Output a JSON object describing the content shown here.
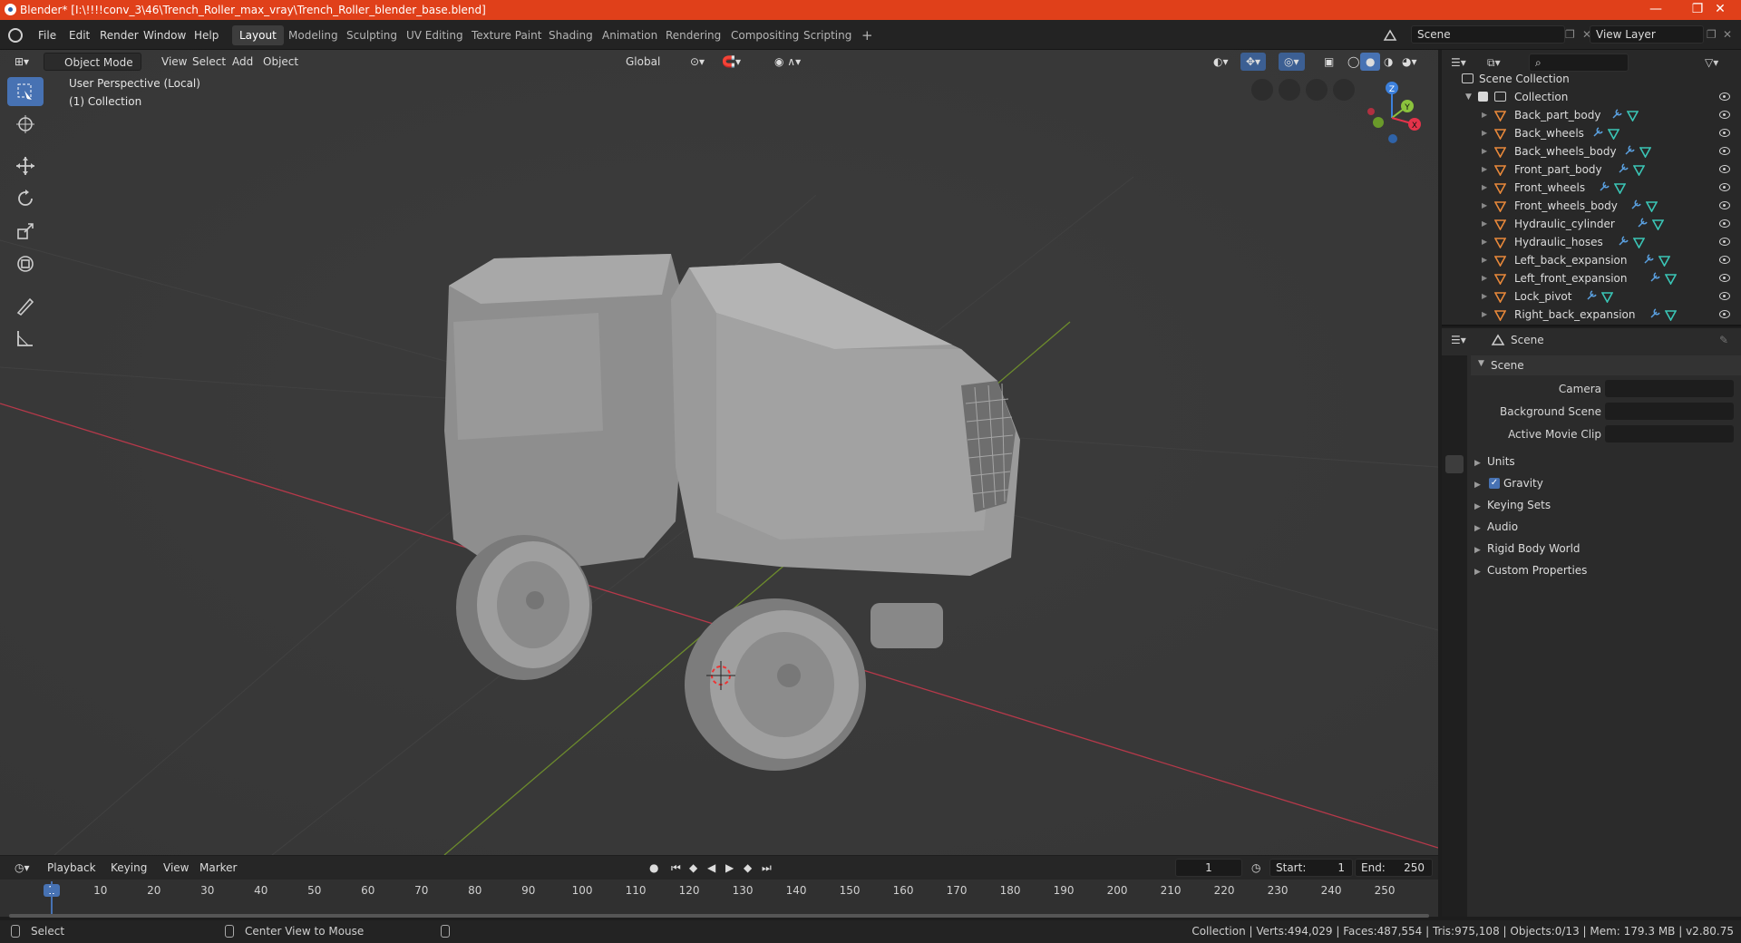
{
  "window": {
    "title": "Blender* [I:\\!!!!conv_3\\46\\Trench_Roller_max_vray\\Trench_Roller_blender_base.blend]",
    "controls": [
      "—",
      "❐",
      "✕"
    ]
  },
  "menu": [
    "File",
    "Edit",
    "Render",
    "Window",
    "Help"
  ],
  "workspaces": [
    "Layout",
    "Modeling",
    "Sculpting",
    "UV Editing",
    "Texture Paint",
    "Shading",
    "Animation",
    "Rendering",
    "Compositing",
    "Scripting"
  ],
  "add_workspace": "+",
  "scene_selector": {
    "value": "Scene"
  },
  "viewlayer_selector": {
    "value": "View Layer"
  },
  "viewport": {
    "mode": "Object Mode",
    "menus": [
      "View",
      "Select",
      "Add",
      "Object"
    ],
    "transform_orientation": "Global",
    "overlay_text": [
      "User Perspective (Local)",
      "(1) Collection"
    ],
    "gizmo_axes": [
      "Z",
      "Y",
      "X"
    ]
  },
  "outliner": {
    "root": "Scene Collection",
    "collection": "Collection",
    "items": [
      "Back_part_body",
      "Back_wheels",
      "Back_wheels_body",
      "Front_part_body",
      "Front_wheels",
      "Front_wheels_body",
      "Hydraulic_cylinder",
      "Hydraulic_hoses",
      "Left_back_expansion",
      "Left_front_expansion",
      "Lock_pivot",
      "Right_back_expansion"
    ]
  },
  "properties": {
    "context": "Scene",
    "panel_title": "Scene",
    "fields": [
      "Camera",
      "Background Scene",
      "Active Movie Clip"
    ],
    "subpanels": [
      "Units",
      "Gravity",
      "Keying Sets",
      "Audio",
      "Rigid Body World",
      "Custom Properties"
    ],
    "gravity_checked": true
  },
  "timeline": {
    "menus": [
      "Playback",
      "Keying",
      "View",
      "Marker"
    ],
    "current_frame": "1",
    "start_label": "Start:",
    "start": "1",
    "end_label": "End:",
    "end": "250",
    "ruler": [
      "1",
      "10",
      "20",
      "30",
      "40",
      "50",
      "60",
      "70",
      "80",
      "90",
      "100",
      "110",
      "120",
      "130",
      "140",
      "150",
      "160",
      "170",
      "180",
      "190",
      "200",
      "210",
      "220",
      "230",
      "240",
      "250"
    ]
  },
  "statusbar": {
    "left": "Select",
    "middle": "Center View to Mouse",
    "right": "Collection | Verts:494,029 | Faces:487,554 | Tris:975,108 | Objects:0/13 | Mem: 179.3 MB | v2.80.75"
  },
  "colors": {
    "titlebar": "#e0401a",
    "active_blue": "#4772b3",
    "object_orange": "#e8883a",
    "mesh_teal": "#3ac5b6",
    "axis_x": "#e4334a",
    "axis_y": "#8bc33d",
    "axis_z": "#3c80dc"
  }
}
